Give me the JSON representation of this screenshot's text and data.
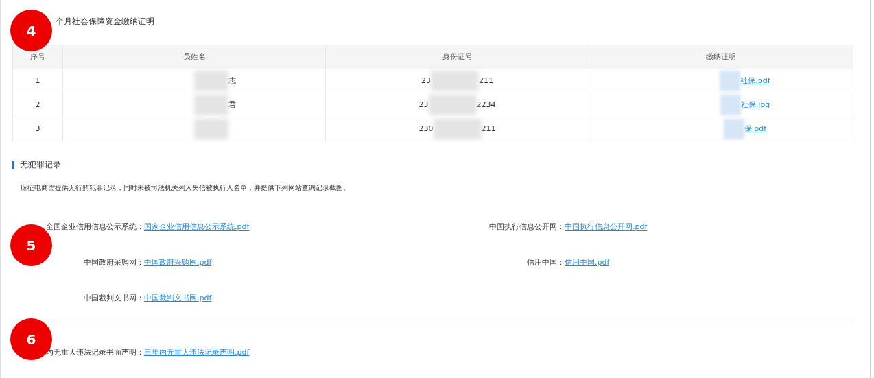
{
  "social_security": {
    "title": "个月社会保障资金缴纳证明",
    "table": {
      "columns": [
        "序号",
        "员姓名",
        "身份证号",
        "缴纳证明"
      ],
      "rows": [
        {
          "index": "1",
          "name": "志",
          "id_parts": [
            "23",
            "211"
          ],
          "proof": "社保.pdf"
        },
        {
          "index": "2",
          "name": "君",
          "id_parts": [
            "23",
            "2234"
          ],
          "proof": "社保.jpg"
        },
        {
          "index": "3",
          "id_parts": [
            "230",
            "211"
          ],
          "proof": "保.pdf"
        }
      ]
    }
  },
  "no_criminal_record": {
    "title": "无犯罪记录",
    "description": "应征电商需提供无行贿犯罪记录，同时未被司法机关列入失信被执行人名单，并提供下列网站查询记录截图。",
    "left_links": [
      {
        "label": "全国企业信用信息公示系统：",
        "file": "国家企业信用信息公示系统.pdf"
      },
      {
        "label": "中国政府采购网：",
        "file": "中国政府采购网.pdf"
      },
      {
        "label": "中国裁判文书网：",
        "file": "中国裁判文书网.pdf"
      }
    ],
    "right_links": [
      {
        "label": "中国执行信息公开网：",
        "file": "中国执行信息公开网.pdf"
      },
      {
        "label": "信用中国：",
        "file": "信用中国.pdf"
      }
    ]
  },
  "declaration": {
    "label": "内无重大违法记录书面声明：",
    "file": "三年内无重大违法记录声明.pdf"
  },
  "markers": [
    "4",
    "5",
    "6"
  ]
}
